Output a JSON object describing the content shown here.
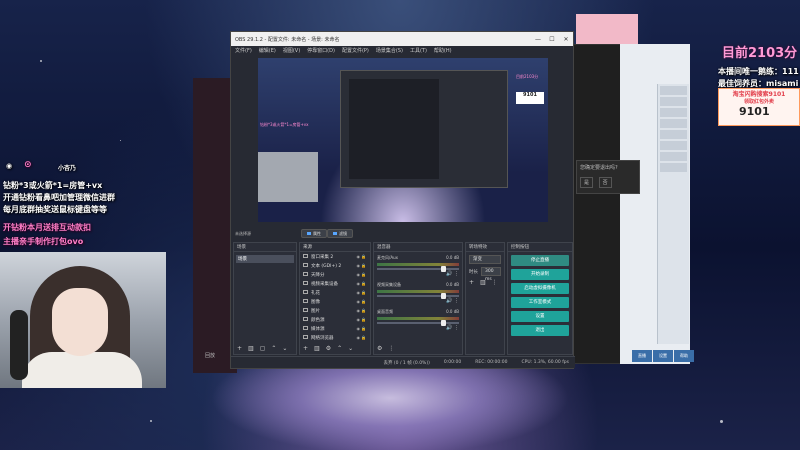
{
  "overlay": {
    "counter": "目前2103分",
    "top_line": "本播间唯一鹅练：111",
    "second_line": "最佳饲养员：misami",
    "promo_title": "淘宝闪购搜索9101",
    "promo_sub": "领取红包外卖",
    "promo_number": "9101",
    "small_name": "小杏乃",
    "line1": "钻粉*3或火箭*1=房管+vx",
    "line2": "开通钻粉看鼻吧加管理微信进群",
    "line3": "每月底群抽奖送鼠标键盘等等",
    "line4": "开钻粉本月送排互动款扣",
    "line5": "主播亲手制作打包ovo"
  },
  "obs": {
    "title": "OBS 29.1.2 - 配置文件: 未命名 - 场景: 未命名",
    "menu": [
      "文件(F)",
      "编辑(E)",
      "视图(V)",
      "停靠窗口(D)",
      "配置文件(P)",
      "场景集合(S)",
      "工具(T)",
      "帮助(H)"
    ],
    "preview_pink_text": "钻粉*3或火箭*1=房管+vx",
    "preview_right_text": "目前2103分",
    "preview_right_box": "9101",
    "toolbar_label": "未选择源",
    "btn_properties": "属性",
    "btn_filters": "滤镜",
    "docks": {
      "scenes": {
        "title": "场景",
        "items": [
          "场景"
        ]
      },
      "sources": {
        "title": "来源",
        "items": [
          "窗口采集 2",
          "文本 (GDI+) 2",
          "天降分",
          "视频采集设备",
          "礼花",
          "图像",
          "图片",
          "颜色源",
          "媒体源",
          "网络浏览器",
          "窗口采集"
        ]
      },
      "mixer": {
        "title": "混音器",
        "channels": [
          {
            "name": "麦克风/Aux",
            "db": "0.0 dB",
            "level": 0.82
          },
          {
            "name": "视频采集设备",
            "db": "0.0 dB",
            "level": 0.82
          },
          {
            "name": "桌面音频",
            "db": "0.0 dB",
            "level": 0.82
          }
        ]
      },
      "transitions": {
        "title": "转场特效",
        "type": "渐变",
        "duration_label": "时长",
        "duration": "300 ms"
      },
      "controls": {
        "title": "控制按钮",
        "buttons": [
          "停止直播",
          "开始录制",
          "启动虚拟摄像机",
          "工作室模式",
          "设置",
          "退出"
        ]
      }
    },
    "status": {
      "cpu": "CPU: 1.3%, 60.00 fps",
      "live": "0:00:00",
      "rec": "REC: 00:00:00",
      "dropped": "丢弃 (0 / 1 帧 (0.0%))",
      "time": "0:00:00"
    }
  },
  "side": {
    "dialog_text": "您确定要退出吗?",
    "dialog_yes": "是",
    "dialog_no": "否",
    "bottom_label": "回放",
    "right_btns": [
      "直播",
      "设置",
      "帮助"
    ]
  }
}
